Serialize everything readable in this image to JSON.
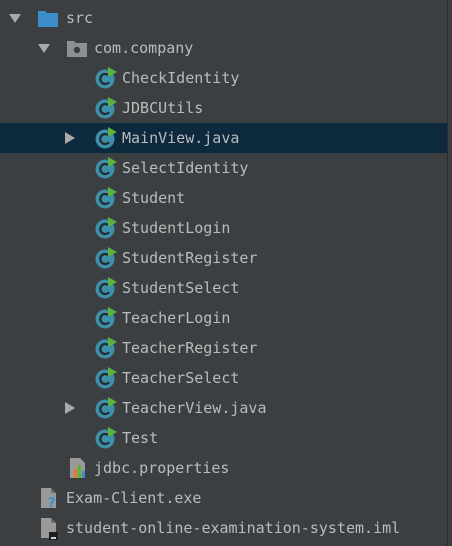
{
  "tree": {
    "src": {
      "label": "src",
      "expanded": true
    },
    "package": {
      "label": "com.company",
      "expanded": true
    },
    "classes": [
      {
        "label": "CheckIdentity",
        "expandable": false
      },
      {
        "label": "JDBCUtils",
        "expandable": false
      },
      {
        "label": "MainView.java",
        "expandable": true,
        "selected": true
      },
      {
        "label": "SelectIdentity",
        "expandable": false
      },
      {
        "label": "Student",
        "expandable": false
      },
      {
        "label": "StudentLogin",
        "expandable": false
      },
      {
        "label": "StudentRegister",
        "expandable": false
      },
      {
        "label": "StudentSelect",
        "expandable": false
      },
      {
        "label": "TeacherLogin",
        "expandable": false
      },
      {
        "label": "TeacherRegister",
        "expandable": false
      },
      {
        "label": "TeacherSelect",
        "expandable": false
      },
      {
        "label": "TeacherView.java",
        "expandable": true
      },
      {
        "label": "Test",
        "expandable": false
      }
    ],
    "properties_file": {
      "label": "jdbc.properties"
    },
    "exe_file": {
      "label": "Exam-Client.exe"
    },
    "iml_file": {
      "label": "student-online-examination-system.iml"
    }
  },
  "colors": {
    "background": "#3c3f41",
    "selection": "#0d293e",
    "text": "#bbbbbb",
    "folder_blue": "#3b8ec9",
    "class_teal": "#3e8fa9",
    "runnable_green": "#59b33d"
  },
  "icons": {
    "folder": "folder-icon",
    "package": "package-icon",
    "java_class": "java-class-icon",
    "properties": "properties-file-icon",
    "unknown_file": "unknown-file-icon",
    "module_file": "module-file-icon"
  }
}
